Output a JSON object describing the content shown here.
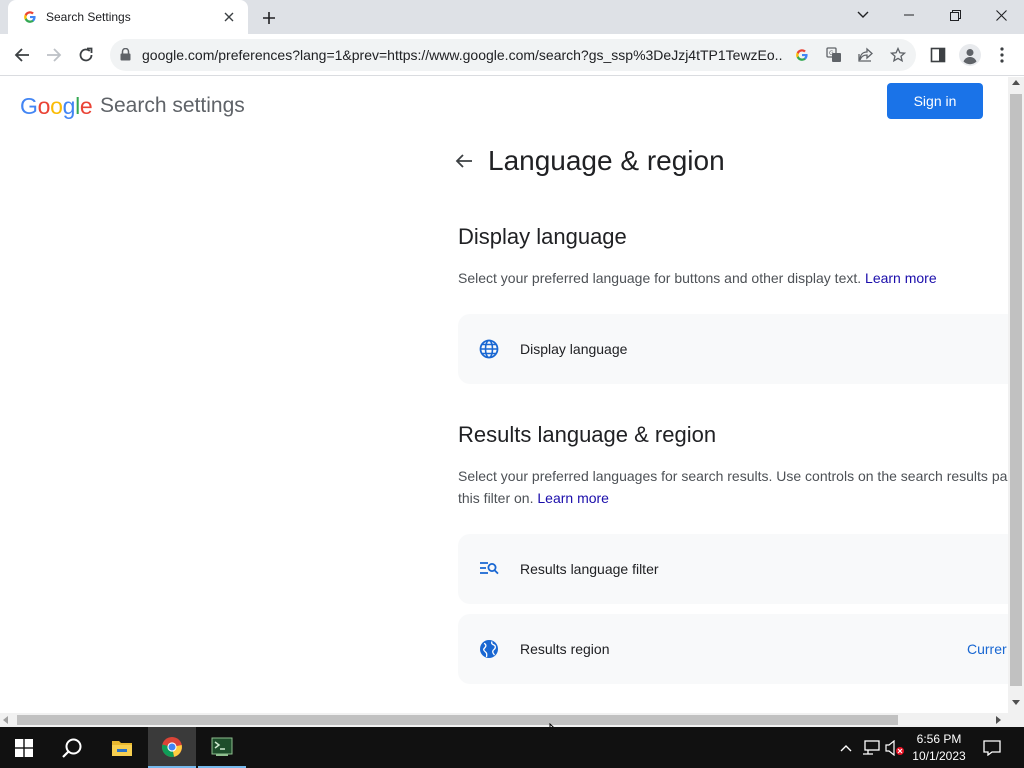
{
  "browser": {
    "tab_title": "Search Settings",
    "url": "google.com/preferences?lang=1&prev=https://www.google.com/search?gs_ssp%3DeJzj4tTP1TewzEo...",
    "icons": [
      "google-favicon",
      "close-icon",
      "plus-icon",
      "chevron-down-icon",
      "minimize-icon",
      "restore-icon",
      "close-icon",
      "back-arrow-icon",
      "forward-arrow-icon",
      "reload-icon",
      "lock-icon",
      "google-lens-icon",
      "translate-icon",
      "share-icon",
      "star-icon",
      "side-panel-icon",
      "profile-icon",
      "more-vert-icon"
    ]
  },
  "page": {
    "logo_text": "Google",
    "title": "Search settings",
    "sign_in": "Sign in",
    "heading": "Language & region",
    "display_language": {
      "title": "Display language",
      "description": "Select your preferred language for buttons and other display text.",
      "learn_more": "Learn more",
      "item_label": "Display language",
      "icon": "globe-icon"
    },
    "results": {
      "title": "Results language & region",
      "description_line1": "Select your preferred languages for search results. Use controls on the search results pa",
      "description_line2": "this filter on.",
      "learn_more": "Learn more",
      "filter_label": "Results language filter",
      "filter_icon": "filter-search-icon",
      "region_label": "Results region",
      "region_icon": "earth-icon",
      "region_value": "Currer"
    }
  },
  "taskbar": {
    "items": [
      "windows-start-icon",
      "search-icon",
      "file-explorer-icon",
      "chrome-icon",
      "terminal-icon"
    ],
    "tray_icons": [
      "chevron-up-icon",
      "network-icon",
      "volume-muted-icon",
      "notification-icon"
    ],
    "time": "6:56 PM",
    "date": "10/1/2023"
  },
  "colors": {
    "accent": "#1a73e8",
    "link": "#1a0dab",
    "google_blue": "#4285F4",
    "google_red": "#EA4335",
    "google_yellow": "#FBBC05",
    "google_green": "#34A853"
  }
}
